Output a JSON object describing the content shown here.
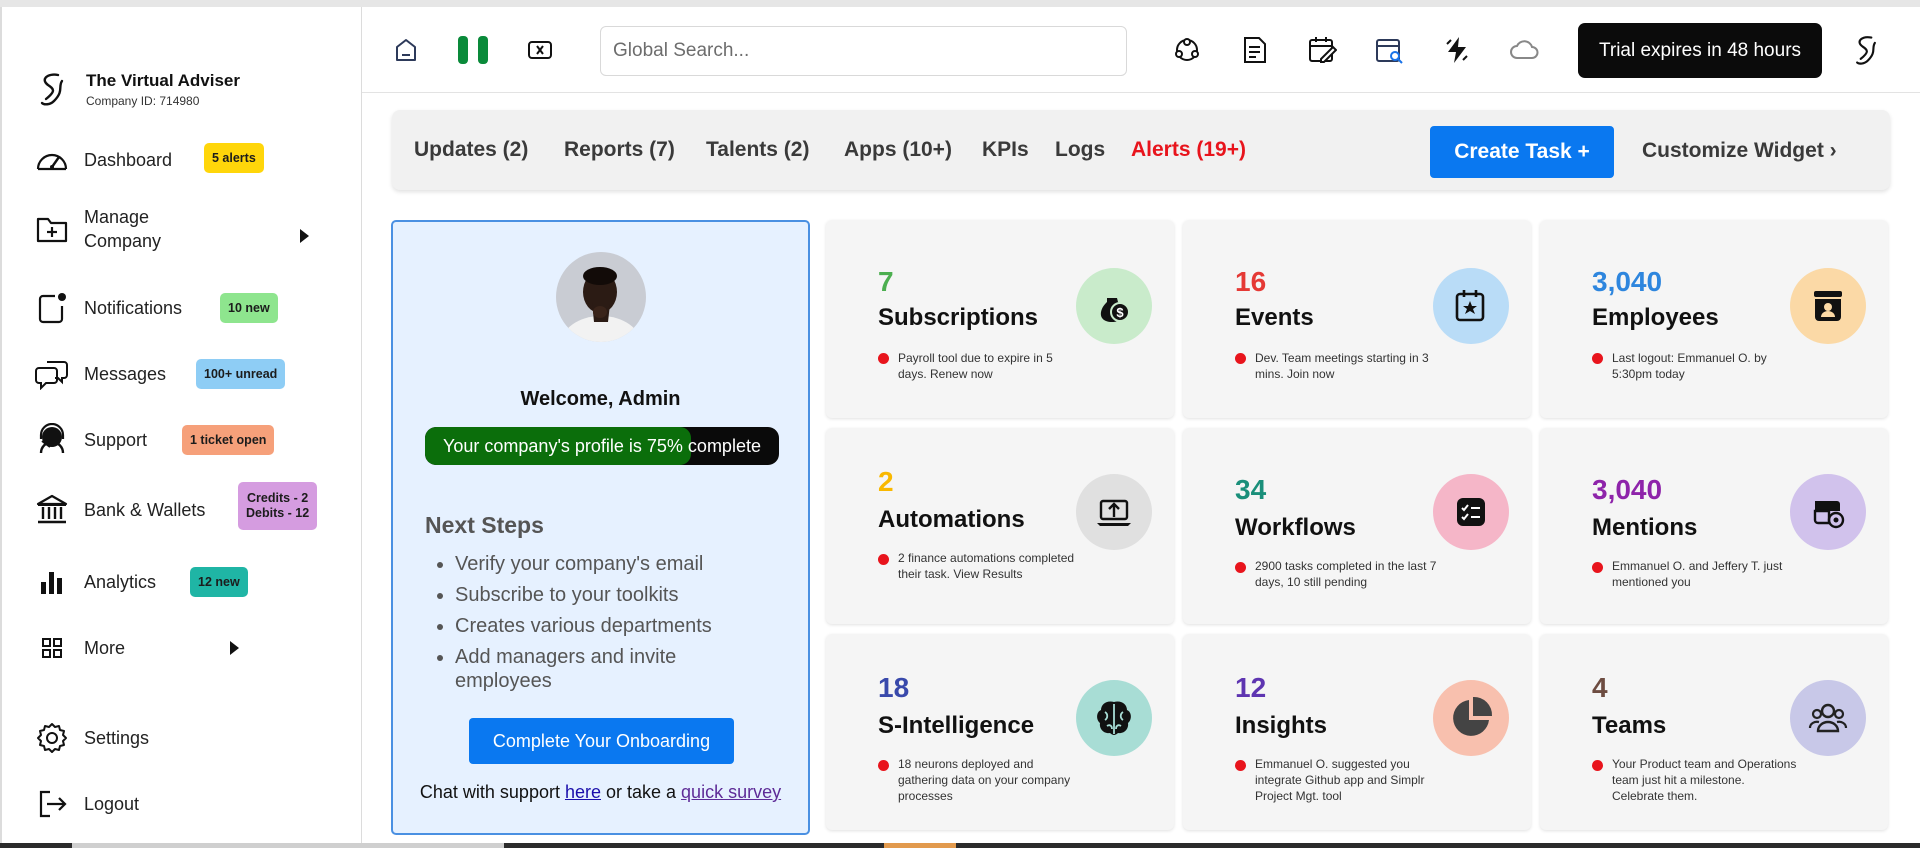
{
  "sidebar": {
    "company_name": "The Virtual Adviser",
    "company_id": "Company ID: 714980",
    "items": [
      {
        "label": "Dashboard",
        "badge": "5 alerts",
        "badge_color": "#ffd60a",
        "icon": "speedometer-icon"
      },
      {
        "label": "Manage\nCompany",
        "icon": "folder-plus-icon"
      },
      {
        "label": "Notifications",
        "badge": "10 new",
        "badge_color": "#8ee58e",
        "icon": "notification-icon"
      },
      {
        "label": "Messages",
        "badge": "100+ unread",
        "badge_color": "#8ecdf5",
        "icon": "chat-bubbles-icon"
      },
      {
        "label": "Support",
        "badge": "1 ticket open",
        "badge_color": "#f6a07a",
        "icon": "headset-icon"
      },
      {
        "label": "Bank & Wallets",
        "badge": "Credits - 2\nDebits - 12",
        "badge_color": "#d59ce0",
        "icon": "bank-icon"
      },
      {
        "label": "Analytics",
        "badge": "12 new",
        "badge_color": "#1fb5a5",
        "icon": "bar-chart-icon"
      },
      {
        "label": "More",
        "icon": "grid-icon"
      },
      {
        "label": "Settings",
        "icon": "gear-icon"
      },
      {
        "label": "Logout",
        "icon": "logout-icon"
      }
    ]
  },
  "topbar": {
    "search_placeholder": "Global Search...",
    "trial_text": "Trial expires in 48 hours",
    "icons": [
      "home-icon",
      "nigeria-flag-icon",
      "media-icon",
      "network-icon",
      "document-icon",
      "calendar-edit-icon",
      "calendar-search-icon",
      "lightning-icon",
      "cloud-icon",
      "brand-logo-icon"
    ]
  },
  "tabs": [
    {
      "label": "Updates (2)"
    },
    {
      "label": "Reports (7)"
    },
    {
      "label": "Talents (2)"
    },
    {
      "label": "Apps (10+)"
    },
    {
      "label": "KPIs"
    },
    {
      "label": "Logs"
    },
    {
      "label": "Alerts (19+)"
    }
  ],
  "actions": {
    "create_task": "Create Task +",
    "customize_widget": "Customize Widget ›"
  },
  "welcome": {
    "title": "Welcome, Admin",
    "progress_text": "Your company's profile is 75% complete",
    "progress_percent": 75,
    "next_steps_title": "Next Steps",
    "steps": [
      "Verify your company's email",
      "Subscribe to your toolkits",
      "Creates various departments",
      "Add managers and invite employees"
    ],
    "onboarding_button": "Complete Your Onboarding",
    "chat_prefix": "Chat with support ",
    "chat_link": "here",
    "chat_middle": " or take a ",
    "survey_link": "quick survey"
  },
  "cards": [
    {
      "value": "7",
      "title": "Subscriptions",
      "note": "Payroll tool due to expire in 5 days. Renew now",
      "value_color": "#4caf50",
      "icon": "money-bag-icon",
      "icon_bg": "#c9ebcb"
    },
    {
      "value": "16",
      "title": "Events",
      "note": "Dev. Team meetings starting in 3 mins. Join now",
      "value_color": "#e53935",
      "icon": "calendar-star-icon",
      "icon_bg": "#b9dcf7"
    },
    {
      "value": "3,040",
      "title": "Employees",
      "note": "Last logout: Emmanuel O. by 5:30pm today",
      "value_color": "#2e86de",
      "icon": "employee-badge-icon",
      "icon_bg": "#fbd9a6"
    },
    {
      "value": "2",
      "title": "Automations",
      "note": "2 finance automations completed their task. View Results",
      "value_color": "#f9b800",
      "icon": "laptop-upload-icon",
      "icon_bg": "#e0e0e0"
    },
    {
      "value": "34",
      "title": "Workflows",
      "note": "2900 tasks completed in the last 7 days, 10 still pending",
      "value_color": "#1a8f7a",
      "icon": "checklist-icon",
      "icon_bg": "#f5b6c8"
    },
    {
      "value": "3,040",
      "title": "Mentions",
      "note": "Emmanuel O. and Jeffery T. just mentioned you",
      "value_color": "#8e24aa",
      "icon": "mention-icon",
      "icon_bg": "#d1c2ec"
    },
    {
      "value": "18",
      "title": "S-Intelligence",
      "note": "18 neurons deployed and gathering data on your company processes",
      "value_color": "#3949ab",
      "icon": "brain-icon",
      "icon_bg": "#a8ddd5"
    },
    {
      "value": "12",
      "title": "Insights",
      "note": "Emmanuel O. suggested you integrate Github app and Simplr Project Mgt. tool",
      "value_color": "#5e35b1",
      "icon": "pie-chart-icon",
      "icon_bg": "#f8c0ae"
    },
    {
      "value": "4",
      "title": "Teams",
      "note": "Your Product team and Operations team just hit a milestone. Celebrate them.",
      "value_color": "#6d4c41",
      "icon": "team-icon",
      "icon_bg": "#c8c8e8"
    }
  ]
}
